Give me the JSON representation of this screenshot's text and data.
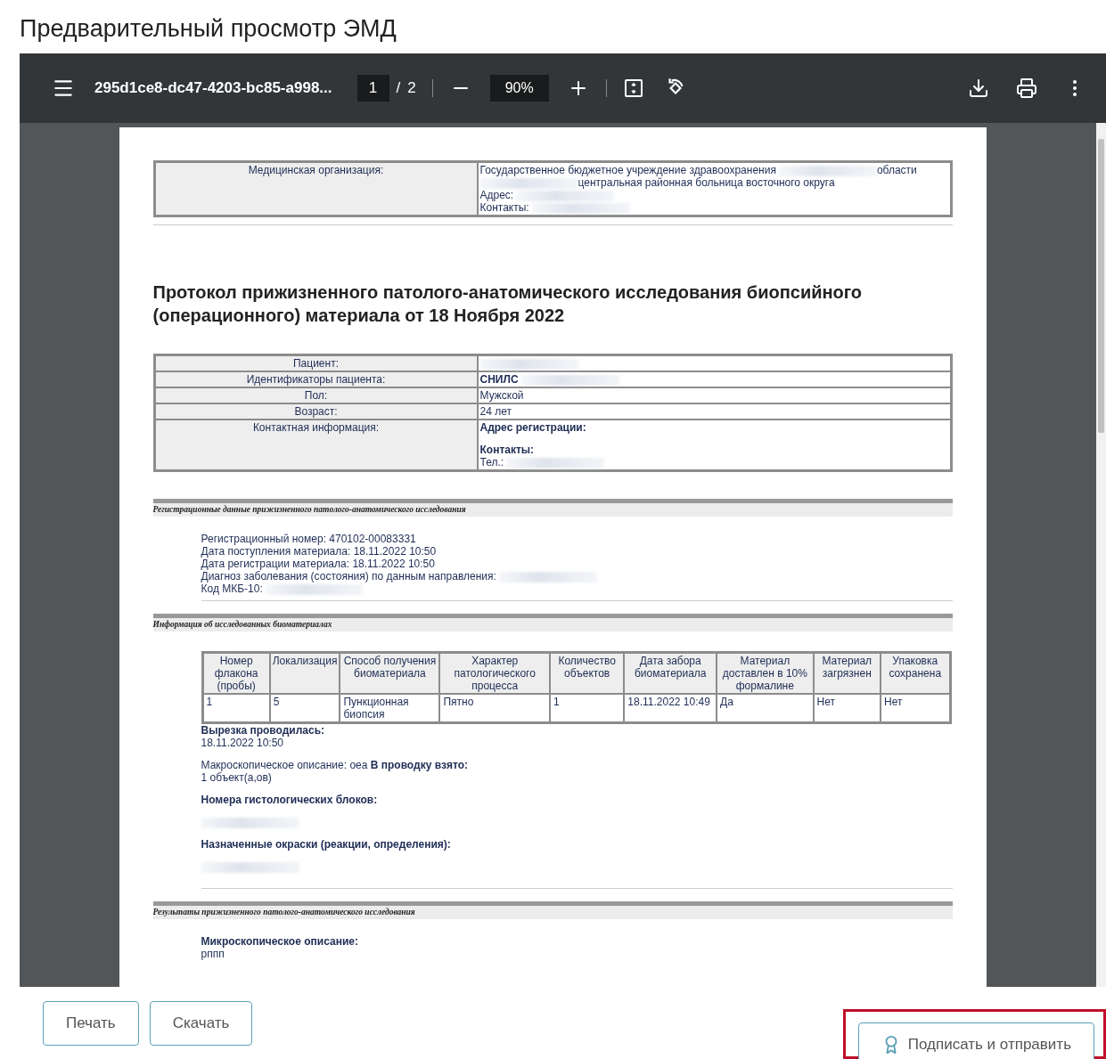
{
  "page_title": "Предварительный просмотр ЭМД",
  "viewer": {
    "file_name": "295d1ce8-dc47-4203-bc85-a998...",
    "page": "1",
    "separator": "/",
    "page_total": "2",
    "zoom": "90%"
  },
  "document": {
    "org_table": {
      "label": "Медицинская организация:",
      "lines": [
        {
          "parts": [
            {
              "kind": "text",
              "text": "Государственное бюджетное учреждение здравоохранения"
            },
            {
              "kind": "redacted"
            },
            {
              "kind": "text",
              "text": "области"
            }
          ]
        },
        {
          "parts": [
            {
              "kind": "redacted"
            },
            {
              "kind": "text",
              "text": "центральная районная больница восточного округа"
            }
          ]
        },
        {
          "parts": [
            {
              "kind": "text",
              "text": "Адрес:"
            },
            {
              "kind": "redacted"
            }
          ]
        },
        {
          "parts": [
            {
              "kind": "text",
              "text": "Контакты:"
            },
            {
              "kind": "redacted"
            }
          ]
        }
      ]
    },
    "title": "Протокол прижизненного патолого-анатомического исследования биопсийного (операционного) материала от 18 Ноября 2022",
    "patient_table": [
      {
        "label": "Пациент:",
        "lines": [
          {
            "parts": [
              {
                "kind": "redacted"
              }
            ]
          }
        ]
      },
      {
        "label": "Идентификаторы пациента:",
        "lines": [
          {
            "parts": [
              {
                "kind": "bold",
                "text": "СНИЛС"
              },
              {
                "kind": "redacted"
              }
            ]
          }
        ]
      },
      {
        "label": "Пол:",
        "lines": [
          {
            "parts": [
              {
                "kind": "text",
                "text": "Мужской"
              }
            ]
          }
        ]
      },
      {
        "label": "Возраст:",
        "lines": [
          {
            "parts": [
              {
                "kind": "text",
                "text": "24 лет"
              }
            ]
          }
        ]
      },
      {
        "label": "Контактная информация:",
        "lines": [
          {
            "parts": [
              {
                "kind": "bold",
                "text": "Адрес регистрации:"
              }
            ]
          },
          {
            "kind": "gap"
          },
          {
            "parts": [
              {
                "kind": "bold",
                "text": "Контакты:"
              }
            ]
          },
          {
            "parts": [
              {
                "kind": "text",
                "text": "Тел.:"
              },
              {
                "kind": "redacted"
              }
            ]
          }
        ]
      }
    ],
    "sections": [
      {
        "heading": "Регистрационные данные прижизненного патолого-анатомического исследования",
        "blocks": [
          {
            "kind": "line",
            "parts": [
              {
                "kind": "text",
                "text": "Регистрационный номер: 470102-00083331"
              }
            ]
          },
          {
            "kind": "line",
            "parts": [
              {
                "kind": "text",
                "text": "Дата поступления материала: 18.11.2022 10:50"
              }
            ]
          },
          {
            "kind": "line",
            "parts": [
              {
                "kind": "text",
                "text": "Дата регистрации материала: 18.11.2022 10:50"
              }
            ]
          },
          {
            "kind": "line",
            "parts": [
              {
                "kind": "text",
                "text": "Диагноз заболевания (состояния) по данным направления:"
              },
              {
                "kind": "redacted"
              }
            ]
          },
          {
            "kind": "line",
            "parts": [
              {
                "kind": "text",
                "text": "Код МКБ-10:"
              },
              {
                "kind": "redacted"
              }
            ]
          }
        ]
      },
      {
        "heading": "Информация об исследованных биоматериалах",
        "blocks": [
          {
            "kind": "table",
            "columns": [
              "Номер флакона (пробы)",
              "Локализация",
              "Способ получения биоматериала",
              "Характер патологического процесса",
              "Количество объектов",
              "Дата забора биоматериала",
              "Материал доставлен в 10% формалине",
              "Материал загрязнен",
              "Упаковка сохранена"
            ],
            "rows": [
              [
                "1",
                "5",
                "Пункционная биопсия",
                "Пятно",
                "1",
                "18.11.2022 10:49",
                "Да",
                "Нет",
                "Нет"
              ]
            ]
          },
          {
            "kind": "line",
            "parts": [
              {
                "kind": "bold",
                "text": "Вырезка проводилась:"
              }
            ]
          },
          {
            "kind": "line",
            "parts": [
              {
                "kind": "text",
                "text": "18.11.2022 10:50"
              }
            ]
          },
          {
            "kind": "gap"
          },
          {
            "kind": "line",
            "parts": [
              {
                "kind": "text",
                "text": "Макроскопическое описание: оеа **В проводку взято:**"
              }
            ]
          },
          {
            "kind": "line",
            "parts": [
              {
                "kind": "text",
                "text": "1 объект(а,ов)"
              }
            ]
          },
          {
            "kind": "gap"
          },
          {
            "kind": "line",
            "parts": [
              {
                "kind": "bold",
                "text": "Номера гистологических блоков:"
              }
            ]
          },
          {
            "kind": "gap"
          },
          {
            "kind": "line",
            "parts": [
              {
                "kind": "redacted"
              }
            ]
          },
          {
            "kind": "gap"
          },
          {
            "kind": "line",
            "parts": [
              {
                "kind": "bold",
                "text": "Назначенные окраски (реакции, определения):"
              }
            ]
          },
          {
            "kind": "gap"
          },
          {
            "kind": "line",
            "parts": [
              {
                "kind": "redacted"
              }
            ]
          },
          {
            "kind": "gap"
          }
        ]
      },
      {
        "heading": "Результаты прижизненного патолого-анатомического исследования",
        "blocks": [
          {
            "kind": "line",
            "parts": [
              {
                "kind": "bold",
                "text": "Микроскопическое описание:"
              }
            ]
          },
          {
            "kind": "line",
            "parts": [
              {
                "kind": "text",
                "text": "рппп"
              }
            ]
          }
        ]
      }
    ]
  },
  "buttons": [
    {
      "label": "Печать",
      "kind": "plain",
      "highlighted": false
    },
    {
      "label": "Скачать",
      "kind": "plain",
      "highlighted": false
    },
    {
      "label": "Подписать и отправить",
      "kind": "sign",
      "highlighted": true
    }
  ]
}
